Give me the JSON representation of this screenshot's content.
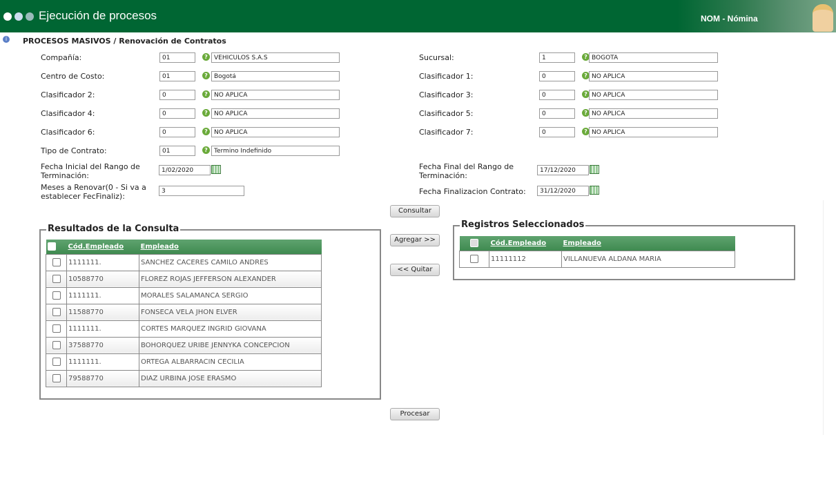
{
  "header": {
    "title": "Ejecución de procesos",
    "module": "NOM - Nómina"
  },
  "breadcrumb": "PROCESOS MASIVOS / Renovación de Contratos",
  "left_fields": [
    {
      "label": "Compañía:",
      "code": "01",
      "desc": "VEHICULOS S.A.S"
    },
    {
      "label": "Centro de Costo:",
      "code": "01",
      "desc": "Bogotá"
    },
    {
      "label": "Clasificador 2:",
      "code": "0",
      "desc": "NO APLICA"
    },
    {
      "label": "Clasificador 4:",
      "code": "0",
      "desc": "NO APLICA"
    },
    {
      "label": "Clasificador 6:",
      "code": "0",
      "desc": "NO APLICA"
    },
    {
      "label": "Tipo de Contrato:",
      "code": "01",
      "desc": "Termino Indefinido"
    }
  ],
  "right_fields": [
    {
      "label": "Sucursal:",
      "code": "1",
      "desc": "BOGOTÁ"
    },
    {
      "label": "Clasificador 1:",
      "code": "0",
      "desc": "NO APLICA"
    },
    {
      "label": "Clasificador 3:",
      "code": "0",
      "desc": "NO APLICA"
    },
    {
      "label": "Clasificador 5:",
      "code": "0",
      "desc": "NO APLICA"
    },
    {
      "label": "Clasificador 7:",
      "code": "0",
      "desc": "NO APLICA"
    }
  ],
  "fecha_inicial": {
    "label": "Fecha Inicial del Rango de Terminación:",
    "value": "1/02/2020"
  },
  "meses": {
    "label": "Meses a Renovar(0 - Si va a establecer FecFinaliz):",
    "value": "3"
  },
  "fecha_final": {
    "label": "Fecha Final del Rango de Terminación:",
    "value": "17/12/2020"
  },
  "fecha_fin_contrato": {
    "label": "Fecha Finalizacion Contrato:",
    "value": "31/12/2020"
  },
  "buttons": {
    "consultar": "Consultar",
    "agregar": "Agregar >>",
    "quitar": "<< Quitar",
    "procesar": "Procesar"
  },
  "results": {
    "title": "Resultados de la Consulta",
    "col_code": "Cód.Empleado",
    "col_name": "Empleado",
    "rows": [
      {
        "code": "1111111.",
        "name": "SANCHEZ CACERES CAMILO ANDRES"
      },
      {
        "code": "10588770",
        "name": "FLOREZ ROJAS JEFFERSON ALEXANDER"
      },
      {
        "code": "1111111.",
        "name": "MORALES SALAMANCA SERGIO"
      },
      {
        "code": "11588770",
        "name": "FONSECA VELA JHON ELVER"
      },
      {
        "code": "1111111.",
        "name": "CORTES MARQUEZ INGRID GIOVANA"
      },
      {
        "code": "37588770",
        "name": "BOHORQUEZ URIBE JENNYKA CONCEPCION"
      },
      {
        "code": "1111111.",
        "name": "ORTEGA ALBARRACIN CECILIA"
      },
      {
        "code": "79588770",
        "name": "DIAZ URBINA JOSE ERASMO"
      }
    ]
  },
  "selected": {
    "title": "Registros Seleccionados",
    "col_code": "Cód.Empleado",
    "col_name": "Empleado",
    "rows": [
      {
        "code": "11111112",
        "name": "VILLANUEVA ALDANA MARIA"
      }
    ]
  }
}
